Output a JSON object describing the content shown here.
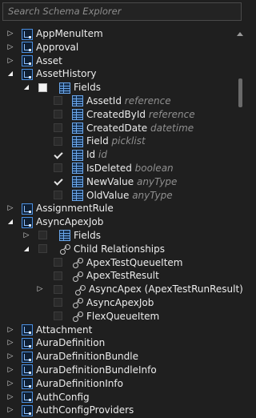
{
  "search": {
    "placeholder": "Search Schema Explorer"
  },
  "rows": [
    {
      "depth": 0,
      "tw": "collapsed",
      "cb": null,
      "icon": "obj",
      "label": "AppMenuItem",
      "type": ""
    },
    {
      "depth": 0,
      "tw": "collapsed",
      "cb": null,
      "icon": "obj",
      "label": "Approval",
      "type": ""
    },
    {
      "depth": 0,
      "tw": "collapsed",
      "cb": null,
      "icon": "obj",
      "label": "Asset",
      "type": ""
    },
    {
      "depth": 0,
      "tw": "expanded",
      "cb": null,
      "icon": "obj",
      "label": "AssetHistory",
      "type": ""
    },
    {
      "depth": 1,
      "tw": "expanded",
      "cb": "white",
      "icon": "grid",
      "label": "Fields",
      "type": ""
    },
    {
      "depth": 2,
      "tw": null,
      "cb": "empty",
      "icon": "grid",
      "label": "AssetId",
      "type": "reference"
    },
    {
      "depth": 2,
      "tw": null,
      "cb": "empty",
      "icon": "grid",
      "label": "CreatedById",
      "type": "reference"
    },
    {
      "depth": 2,
      "tw": null,
      "cb": "empty",
      "icon": "grid",
      "label": "CreatedDate",
      "type": "datetime"
    },
    {
      "depth": 2,
      "tw": null,
      "cb": "empty",
      "icon": "grid",
      "label": "Field",
      "type": "picklist"
    },
    {
      "depth": 2,
      "tw": null,
      "cb": "checked",
      "icon": "grid",
      "label": "Id",
      "type": "id"
    },
    {
      "depth": 2,
      "tw": null,
      "cb": "empty",
      "icon": "grid",
      "label": "IsDeleted",
      "type": "boolean"
    },
    {
      "depth": 2,
      "tw": null,
      "cb": "checked",
      "icon": "grid",
      "label": "NewValue",
      "type": "anyType"
    },
    {
      "depth": 2,
      "tw": null,
      "cb": "empty",
      "icon": "grid",
      "label": "OldValue",
      "type": "anyType"
    },
    {
      "depth": 0,
      "tw": "collapsed",
      "cb": null,
      "icon": "obj",
      "label": "AssignmentRule",
      "type": ""
    },
    {
      "depth": 0,
      "tw": "expanded",
      "cb": null,
      "icon": "obj",
      "label": "AsyncApexJob",
      "type": ""
    },
    {
      "depth": 1,
      "tw": "collapsed",
      "cb": "empty",
      "icon": "grid",
      "label": "Fields",
      "type": ""
    },
    {
      "depth": 1,
      "tw": "expanded",
      "cb": "empty",
      "icon": "rel",
      "label": "Child Relationships",
      "type": ""
    },
    {
      "depth": 2,
      "tw": null,
      "cb": "empty",
      "icon": "rel",
      "label": "ApexTestQueueItem",
      "type": ""
    },
    {
      "depth": 2,
      "tw": null,
      "cb": "empty",
      "icon": "rel",
      "label": "ApexTestResult",
      "type": ""
    },
    {
      "depth": 3,
      "tw": "collapsed",
      "cb": "empty",
      "icon": "rel",
      "label": "AsyncApex (ApexTestRunResult)",
      "type": ""
    },
    {
      "depth": 2,
      "tw": null,
      "cb": "empty",
      "icon": "rel",
      "label": "AsyncApexJob",
      "type": ""
    },
    {
      "depth": 2,
      "tw": null,
      "cb": "empty",
      "icon": "rel",
      "label": "FlexQueueItem",
      "type": ""
    },
    {
      "depth": 0,
      "tw": "collapsed",
      "cb": null,
      "icon": "obj",
      "label": "Attachment",
      "type": ""
    },
    {
      "depth": 0,
      "tw": "collapsed",
      "cb": null,
      "icon": "obj",
      "label": "AuraDefinition",
      "type": ""
    },
    {
      "depth": 0,
      "tw": "collapsed",
      "cb": null,
      "icon": "obj",
      "label": "AuraDefinitionBundle",
      "type": ""
    },
    {
      "depth": 0,
      "tw": "collapsed",
      "cb": null,
      "icon": "obj",
      "label": "AuraDefinitionBundleInfo",
      "type": ""
    },
    {
      "depth": 0,
      "tw": "collapsed",
      "cb": null,
      "icon": "obj",
      "label": "AuraDefinitionInfo",
      "type": ""
    },
    {
      "depth": 0,
      "tw": "collapsed",
      "cb": null,
      "icon": "obj",
      "label": "AuthConfig",
      "type": ""
    },
    {
      "depth": 0,
      "tw": "collapsed",
      "cb": null,
      "icon": "obj",
      "label": "AuthConfigProviders",
      "type": ""
    }
  ]
}
